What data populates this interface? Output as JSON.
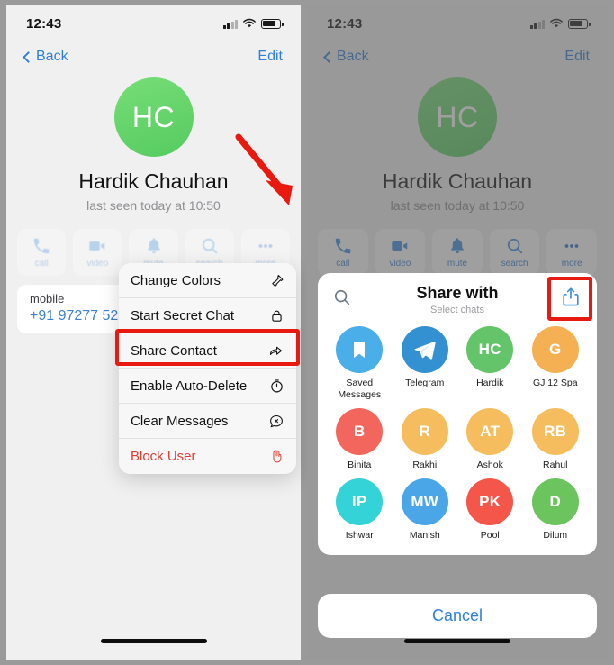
{
  "left": {
    "status": {
      "time": "12:43"
    },
    "nav": {
      "back": "Back",
      "edit": "Edit"
    },
    "profile": {
      "initials": "HC",
      "name": "Hardik Chauhan",
      "subtitle": "last seen today at 10:50",
      "avatar_color": "#5ecb63"
    },
    "actions": [
      {
        "label": "call",
        "icon": "phone-icon"
      },
      {
        "label": "video",
        "icon": "video-camera-icon"
      },
      {
        "label": "mute",
        "icon": "bell-icon"
      },
      {
        "label": "search",
        "icon": "search-icon"
      },
      {
        "label": "more",
        "icon": "ellipsis-icon"
      }
    ],
    "info": {
      "key": "mobile",
      "value": "+91 97277 52"
    },
    "menu": [
      {
        "label": "Change Colors",
        "icon": "paint-roller-icon",
        "danger": false
      },
      {
        "label": "Start Secret Chat",
        "icon": "lock-icon",
        "danger": false
      },
      {
        "label": "Share Contact",
        "icon": "forward-arrow-icon",
        "danger": false
      },
      {
        "label": "Enable Auto-Delete",
        "icon": "timer-icon",
        "danger": false
      },
      {
        "label": "Clear Messages",
        "icon": "chat-x-icon",
        "danger": false
      },
      {
        "label": "Block User",
        "icon": "stop-hand-icon",
        "danger": true
      }
    ],
    "annotations": {
      "arrow": "red-arrow-pointing-to-more-button",
      "highlight": "red-box-around-share-contact",
      "highlight_color": "#e8190f"
    }
  },
  "right": {
    "status": {
      "time": "12:43"
    },
    "nav": {
      "back": "Back",
      "edit": "Edit"
    },
    "profile": {
      "initials": "HC",
      "name": "Hardik Chauhan",
      "subtitle": "last seen today at 10:50",
      "avatar_color": "#3f9b47"
    },
    "actions": [
      {
        "label": "call",
        "icon": "phone-icon"
      },
      {
        "label": "video",
        "icon": "video-camera-icon"
      },
      {
        "label": "mute",
        "icon": "bell-icon"
      },
      {
        "label": "search",
        "icon": "search-icon"
      },
      {
        "label": "more",
        "icon": "ellipsis-icon"
      }
    ],
    "sheet": {
      "title": "Share with",
      "subtitle": "Select chats",
      "search_icon": "search-icon",
      "export_icon": "share-export-icon",
      "chats": [
        {
          "name": "Saved Messages",
          "initials": "",
          "icon": "bookmark-icon",
          "color": "#4aaee8"
        },
        {
          "name": "Telegram",
          "initials": "",
          "icon": "telegram-plane-icon",
          "color": "#3390d1"
        },
        {
          "name": "Hardik",
          "initials": "HC",
          "icon": "",
          "color": "#64c46a"
        },
        {
          "name": "GJ 12 Spa",
          "initials": "G",
          "icon": "",
          "color": "#f4b053"
        },
        {
          "name": "Binita",
          "initials": "B",
          "icon": "",
          "color": "#f2665e"
        },
        {
          "name": "Rakhi",
          "initials": "R",
          "icon": "",
          "color": "#f6bd5f"
        },
        {
          "name": "Ashok",
          "initials": "AT",
          "icon": "",
          "color": "#f6bd5f"
        },
        {
          "name": "Rahul",
          "initials": "RB",
          "icon": "",
          "color": "#f6bd5f"
        },
        {
          "name": "Ishwar",
          "initials": "IP",
          "icon": "",
          "color": "#34d3d8"
        },
        {
          "name": "Manish",
          "initials": "MW",
          "icon": "",
          "color": "#4ba6e8"
        },
        {
          "name": "Pool",
          "initials": "PK",
          "icon": "",
          "color": "#f4564a"
        },
        {
          "name": "Dilum",
          "initials": "D",
          "icon": "",
          "color": "#6cc45f"
        }
      ],
      "cancel": "Cancel"
    },
    "annotations": {
      "highlight": "red-box-around-export-icon",
      "highlight_color": "#e8190f"
    }
  }
}
